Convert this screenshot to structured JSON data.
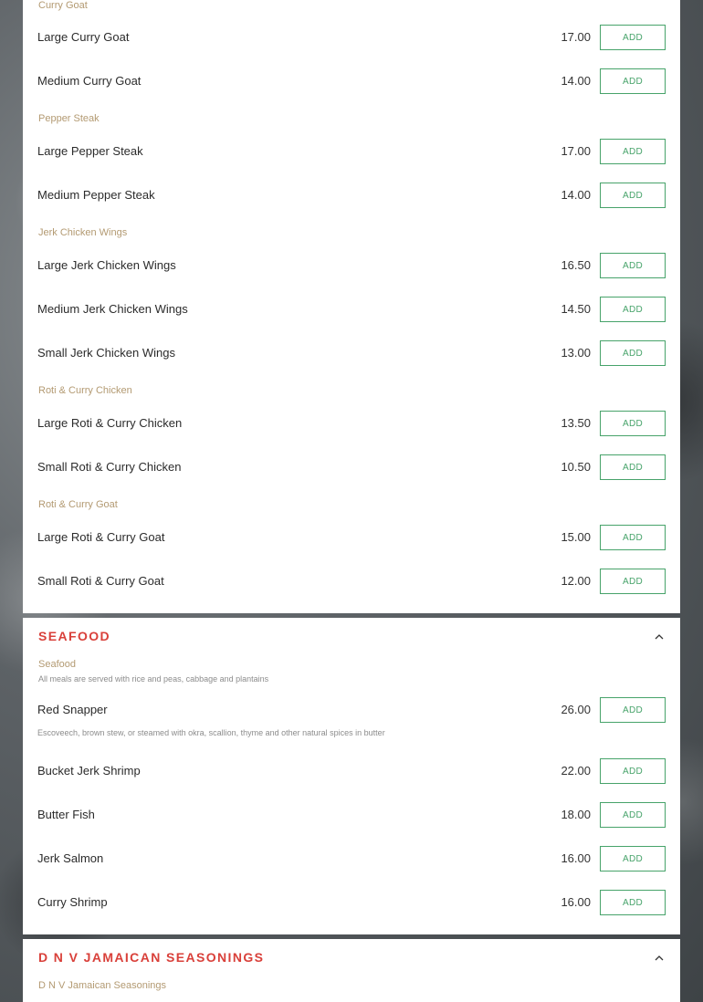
{
  "colors": {
    "category": "#d9403a",
    "subcategory": "#b39a72",
    "add_button": "#47a36a"
  },
  "panel1": {
    "sub_curry_goat": "Curry Goat",
    "items_curry_goat": [
      {
        "name": "Large Curry Goat",
        "price": "17.00",
        "button": "ADD"
      },
      {
        "name": "Medium Curry Goat",
        "price": "14.00",
        "button": "ADD"
      }
    ],
    "sub_pepper_steak": "Pepper Steak",
    "items_pepper_steak": [
      {
        "name": "Large Pepper Steak",
        "price": "17.00",
        "button": "ADD"
      },
      {
        "name": "Medium Pepper Steak",
        "price": "14.00",
        "button": "ADD"
      }
    ],
    "sub_jerk_wings": "Jerk Chicken Wings",
    "items_jerk_wings": [
      {
        "name": "Large Jerk Chicken Wings",
        "price": "16.50",
        "button": "ADD"
      },
      {
        "name": "Medium Jerk Chicken Wings",
        "price": "14.50",
        "button": "ADD"
      },
      {
        "name": "Small Jerk Chicken Wings",
        "price": "13.00",
        "button": "ADD"
      }
    ],
    "sub_roti_chicken": "Roti & Curry Chicken",
    "items_roti_chicken": [
      {
        "name": "Large Roti & Curry Chicken",
        "price": "13.50",
        "button": "ADD"
      },
      {
        "name": "Small Roti & Curry Chicken",
        "price": "10.50",
        "button": "ADD"
      }
    ],
    "sub_roti_goat": "Roti & Curry Goat",
    "items_roti_goat": [
      {
        "name": "Large Roti & Curry Goat",
        "price": "15.00",
        "button": "ADD"
      },
      {
        "name": "Small Roti & Curry Goat",
        "price": "12.00",
        "button": "ADD"
      }
    ]
  },
  "seafood": {
    "title": "SEAFOOD",
    "chevron_icon": "chevron-up-icon",
    "sub_label": "Seafood",
    "sub_desc": "All meals are served with rice and peas, cabbage and plantains",
    "items": [
      {
        "name": "Red Snapper",
        "price": "26.00",
        "button": "ADD",
        "desc": "Escoveech, brown stew, or steamed with okra, scallion, thyme and other natural spices in butter"
      },
      {
        "name": "Bucket Jerk Shrimp",
        "price": "22.00",
        "button": "ADD"
      },
      {
        "name": "Butter Fish",
        "price": "18.00",
        "button": "ADD"
      },
      {
        "name": "Jerk Salmon",
        "price": "16.00",
        "button": "ADD"
      },
      {
        "name": "Curry Shrimp",
        "price": "16.00",
        "button": "ADD"
      }
    ]
  },
  "seasonings": {
    "title": "D N V JAMAICAN SEASONINGS",
    "chevron_icon": "chevron-up-icon",
    "sub_label": "D N V Jamaican Seasonings"
  }
}
